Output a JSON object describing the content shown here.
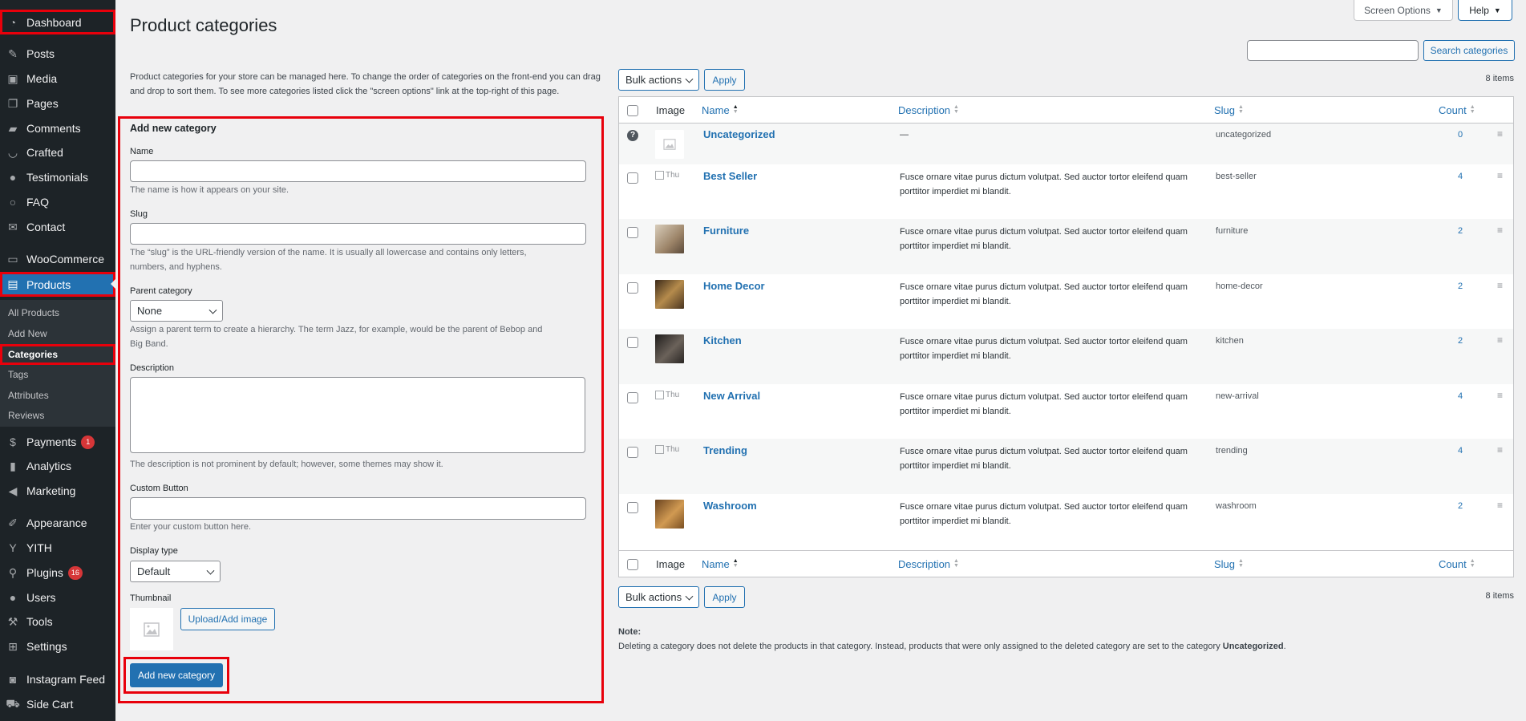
{
  "sidebar": {
    "items": [
      {
        "label": "Dashboard",
        "icon": "dashboard-icon"
      },
      {
        "label": "Posts",
        "icon": "pin-icon"
      },
      {
        "label": "Media",
        "icon": "media-icon"
      },
      {
        "label": "Pages",
        "icon": "pages-icon"
      },
      {
        "label": "Comments",
        "icon": "comment-icon"
      },
      {
        "label": "Crafted",
        "icon": "crafted-icon"
      },
      {
        "label": "Testimonials",
        "icon": "user-icon"
      },
      {
        "label": "FAQ",
        "icon": "faq-icon"
      },
      {
        "label": "Contact",
        "icon": "mail-icon"
      },
      {
        "label": "WooCommerce",
        "icon": "woo-icon"
      },
      {
        "label": "Products",
        "icon": "archive-icon"
      },
      {
        "label": "Payments",
        "icon": "dollar-icon",
        "badge": "1"
      },
      {
        "label": "Analytics",
        "icon": "chart-icon"
      },
      {
        "label": "Marketing",
        "icon": "megaphone-icon"
      },
      {
        "label": "Appearance",
        "icon": "brush-icon"
      },
      {
        "label": "YITH",
        "icon": "yith-icon"
      },
      {
        "label": "Plugins",
        "icon": "plugin-icon",
        "badge": "16"
      },
      {
        "label": "Users",
        "icon": "users-icon"
      },
      {
        "label": "Tools",
        "icon": "wrench-icon"
      },
      {
        "label": "Settings",
        "icon": "settings-icon"
      },
      {
        "label": "Instagram Feed",
        "icon": "instagram-icon"
      },
      {
        "label": "Side Cart",
        "icon": "cart-icon"
      }
    ],
    "submenu": [
      "All Products",
      "Add New",
      "Categories",
      "Tags",
      "Attributes",
      "Reviews"
    ]
  },
  "header": {
    "title": "Product categories",
    "screen_options": "Screen Options",
    "help": "Help"
  },
  "search": {
    "value": "",
    "button": "Search categories"
  },
  "intro": "Product categories for your store can be managed here. To change the order of categories on the front-end you can drag and drop to sort them. To see more categories listed click the \"screen options\" link at the top-right of this page.",
  "form": {
    "heading": "Add new category",
    "name_label": "Name",
    "name_value": "",
    "name_help": "The name is how it appears on your site.",
    "slug_label": "Slug",
    "slug_value": "",
    "slug_help_1": "The “slug” is the URL-friendly version of the name. It is usually all lowercase and contains only letters,",
    "slug_help_2": "numbers, and hyphens.",
    "parent_label": "Parent category",
    "parent_value": "None",
    "parent_help_1": "Assign a parent term to create a hierarchy. The term Jazz, for example, would be the parent of Bebop and",
    "parent_help_2": "Big Band.",
    "description_label": "Description",
    "description_value": "",
    "description_help": "The description is not prominent by default; however, some themes may show it.",
    "custom_button_label": "Custom Button",
    "custom_button_value": "",
    "custom_button_help": "Enter your custom button here.",
    "display_type_label": "Display type",
    "display_type_value": "Default",
    "thumbnail_label": "Thumbnail",
    "upload_button": "Upload/Add image",
    "submit_button": "Add new category"
  },
  "bulk": {
    "label": "Bulk actions",
    "apply": "Apply",
    "count": "8 items"
  },
  "table": {
    "headers": {
      "image": "Image",
      "name": "Name",
      "description": "Description",
      "slug": "Slug",
      "count": "Count"
    },
    "rows": [
      {
        "name": "Uncategorized",
        "description": "—",
        "slug": "uncategorized",
        "count": "0",
        "thumb": "placeholder"
      },
      {
        "name": "Best Seller",
        "description": "Fusce ornare vitae purus dictum volutpat. Sed auctor tortor eleifend quam porttitor imperdiet mi blandit.",
        "slug": "best-seller",
        "count": "4",
        "thumb": "broken",
        "thumb_alt": "Thu"
      },
      {
        "name": "Furniture",
        "description": "Fusce ornare vitae purus dictum volutpat. Sed auctor tortor eleifend quam porttitor imperdiet mi blandit.",
        "slug": "furniture",
        "count": "2",
        "thumb": "image",
        "color": "#b9a78f"
      },
      {
        "name": "Home Decor",
        "description": "Fusce ornare vitae purus dictum volutpat. Sed auctor tortor eleifend quam porttitor imperdiet mi blandit.",
        "slug": "home-decor",
        "count": "2",
        "thumb": "image",
        "color": "#7a5a32"
      },
      {
        "name": "Kitchen",
        "description": "Fusce ornare vitae purus dictum volutpat. Sed auctor tortor eleifend quam porttitor imperdiet mi blandit.",
        "slug": "kitchen",
        "count": "2",
        "thumb": "image",
        "color": "#3d3a38"
      },
      {
        "name": "New Arrival",
        "description": "Fusce ornare vitae purus dictum volutpat. Sed auctor tortor eleifend quam porttitor imperdiet mi blandit.",
        "slug": "new-arrival",
        "count": "4",
        "thumb": "broken",
        "thumb_alt": "Thu"
      },
      {
        "name": "Trending",
        "description": "Fusce ornare vitae purus dictum volutpat. Sed auctor tortor eleifend quam porttitor imperdiet mi blandit.",
        "slug": "trending",
        "count": "4",
        "thumb": "broken",
        "thumb_alt": "Thu"
      },
      {
        "name": "Washroom",
        "description": "Fusce ornare vitae purus dictum volutpat. Sed auctor tortor eleifend quam porttitor imperdiet mi blandit.",
        "slug": "washroom",
        "count": "2",
        "thumb": "image",
        "color": "#a8753d"
      }
    ]
  },
  "note": {
    "label": "Note:",
    "text": "Deleting a category does not delete the products in that category. Instead, products that were only assigned to the deleted category are set to the category ",
    "strong": "Uncategorized",
    "end": "."
  },
  "colors": {
    "accent": "#2271b1",
    "highlight": "#e8000b",
    "sidebar": "#1d2327"
  }
}
